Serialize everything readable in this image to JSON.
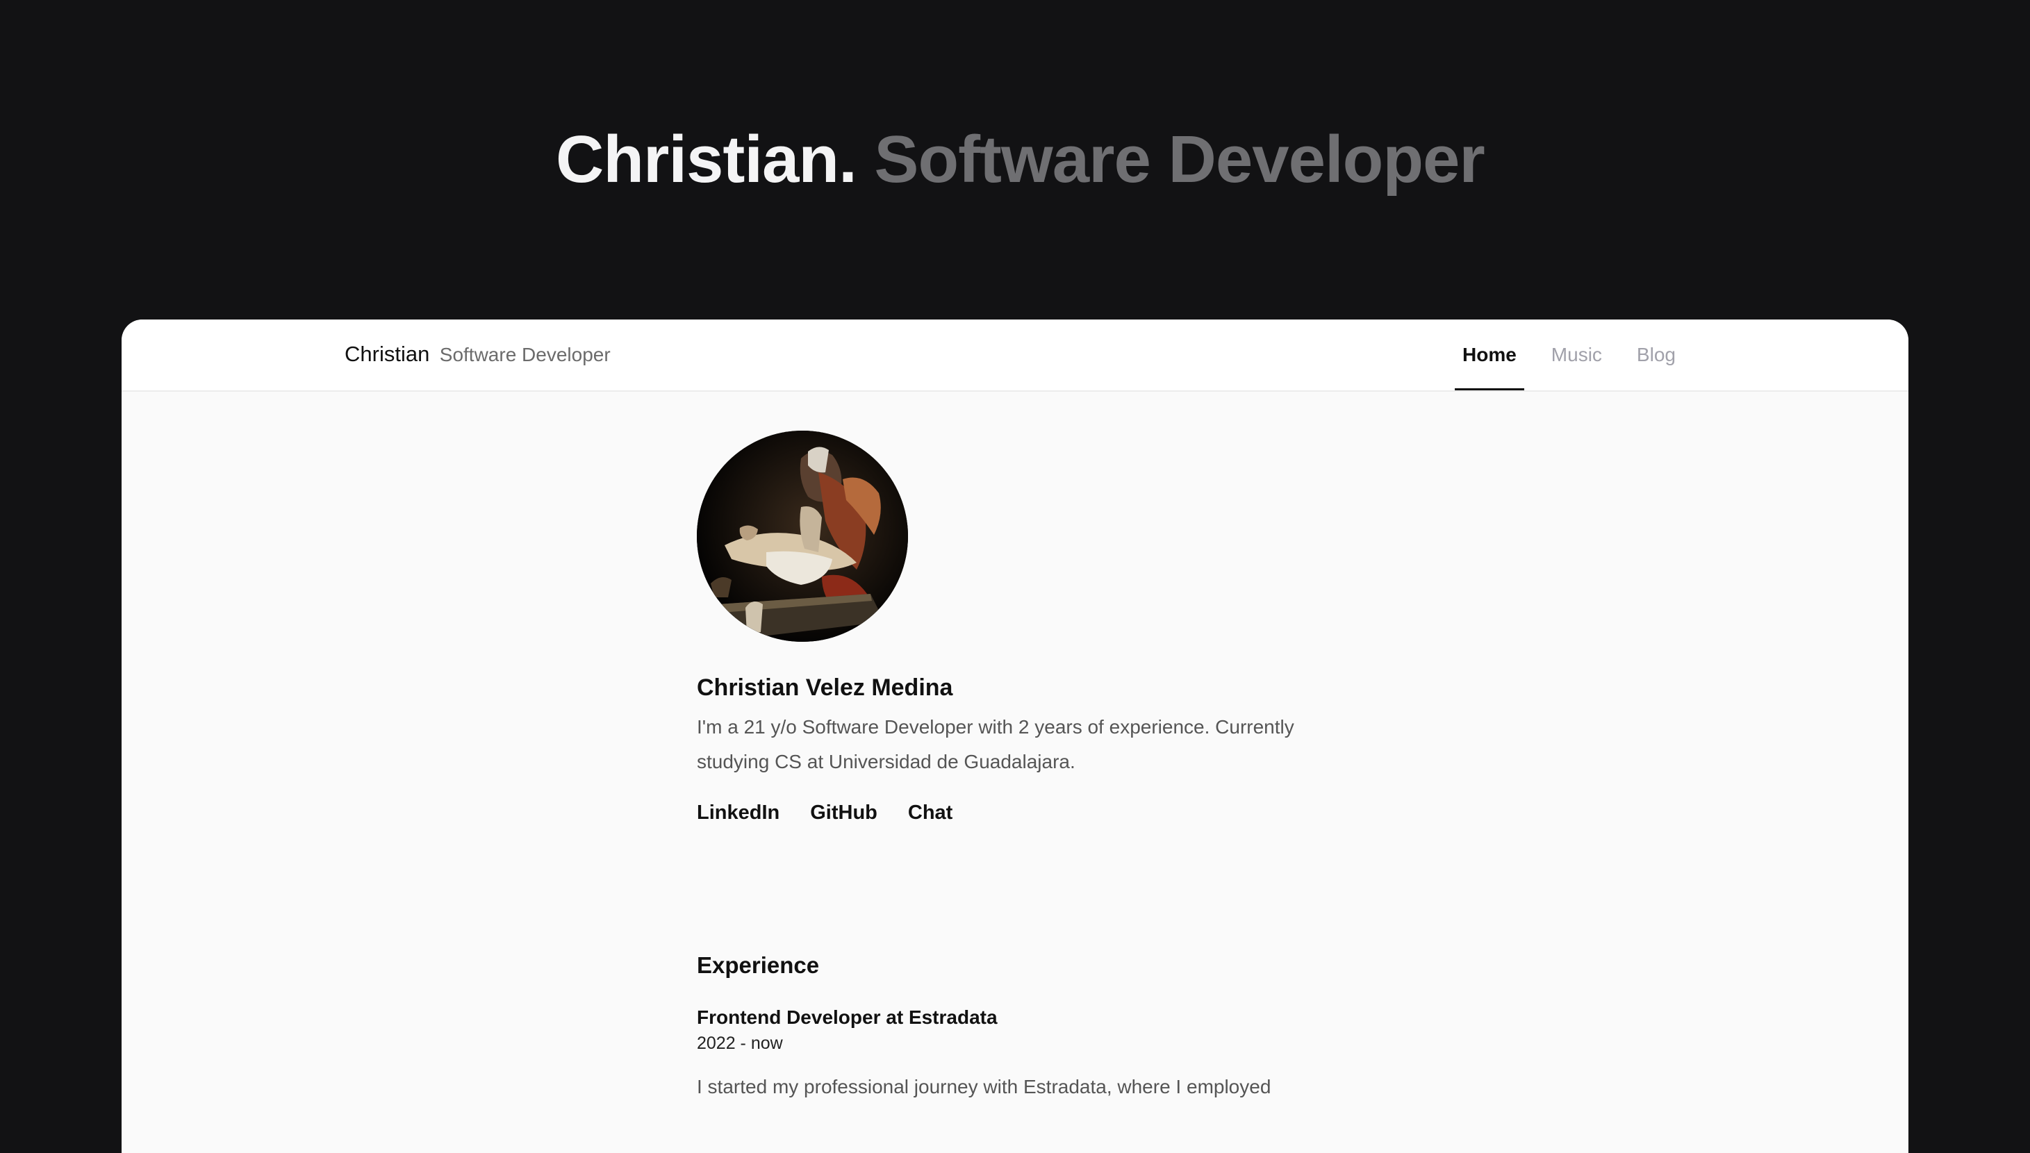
{
  "hero": {
    "name": "Christian.",
    "role": "Software Developer"
  },
  "navbar": {
    "brand_name": "Christian",
    "brand_role": "Software Developer",
    "items": [
      {
        "label": "Home",
        "active": true
      },
      {
        "label": "Music",
        "active": false
      },
      {
        "label": "Blog",
        "active": false
      }
    ]
  },
  "profile": {
    "name": "Christian Velez Medina",
    "bio": "I'm a 21 y/o Software Developer with 2 years of experience. Currently studying CS at Universidad de Guadalajara.",
    "links": [
      "LinkedIn",
      "GitHub",
      "Chat"
    ]
  },
  "experience": {
    "title": "Experience",
    "jobs": [
      {
        "title": "Frontend Developer at Estradata",
        "dates": "2022 - now",
        "description": "I started my professional journey with Estradata, where I employed"
      }
    ]
  },
  "colors": {
    "page_bg": "#121214",
    "hero_name": "#f4f4f5",
    "hero_role": "#6f6f72",
    "window_bg": "#fafafa",
    "nav_active": "#111111",
    "nav_inactive": "#a1a1aa"
  }
}
